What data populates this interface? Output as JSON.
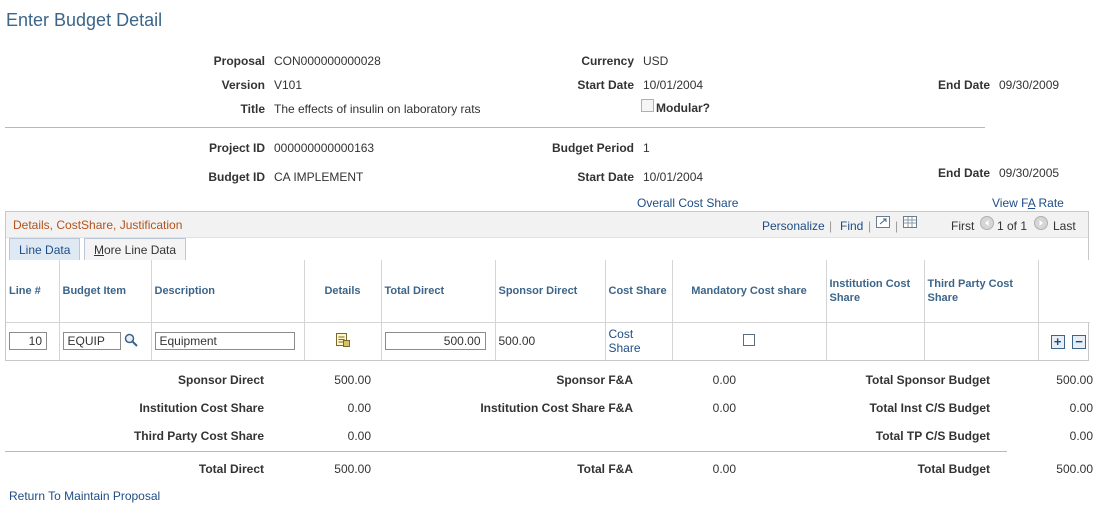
{
  "page": {
    "title": "Enter Budget Detail"
  },
  "header": {
    "proposal_label": "Proposal",
    "proposal": "CON000000000028",
    "currency_label": "Currency",
    "currency": "USD",
    "version_label": "Version",
    "version": "V101",
    "start_date_label": "Start Date",
    "start_date": "10/01/2004",
    "end_date_label": "End Date",
    "end_date": "09/30/2009",
    "title_label": "Title",
    "title": "The effects of insulin on laboratory rats",
    "modular_label": "Modular?",
    "modular_checked": false
  },
  "period": {
    "project_id_label": "Project ID",
    "project_id": "000000000000163",
    "budget_period_label": "Budget Period",
    "budget_period": "1",
    "budget_id_label": "Budget ID",
    "budget_id": "CA IMPLEMENT",
    "start_date_label": "Start Date",
    "start_date": "10/01/2004",
    "end_date_label": "End Date",
    "end_date": "09/30/2005"
  },
  "links": {
    "overall_cost_share": "Overall Cost Share",
    "view_fa_rate": "View FA Rate",
    "return": "Return To Maintain Proposal"
  },
  "grid": {
    "title": "Details, CostShare, Justification",
    "personalize": "Personalize",
    "find": "Find",
    "pager_first": "First",
    "pager_range": "1 of 1",
    "pager_last": "Last",
    "tabs": [
      "Line Data",
      "More Line Data"
    ],
    "columns": {
      "line": "Line #",
      "budget_item": "Budget Item",
      "description": "Description",
      "details": "Details",
      "total_direct": "Total Direct",
      "sponsor_direct": "Sponsor Direct",
      "cost_share": "Cost Share",
      "mandatory_cost_share": "Mandatory Cost share",
      "institution_cost_share": "Institution Cost Share",
      "third_party_cost_share": "Third Party Cost Share"
    },
    "row": {
      "line": "10",
      "budget_item": "EQUIP",
      "description": "Equipment",
      "total_direct": "500.00",
      "sponsor_direct": "500.00",
      "cost_share_link": "Cost Share",
      "mandatory_checked": false
    }
  },
  "totals": {
    "sponsor_direct_label": "Sponsor Direct",
    "sponsor_direct": "500.00",
    "sponsor_fa_label": "Sponsor F&A",
    "sponsor_fa": "0.00",
    "total_sponsor_budget_label": "Total Sponsor Budget",
    "total_sponsor_budget": "500.00",
    "institution_cost_share_label": "Institution Cost Share",
    "institution_cost_share": "0.00",
    "institution_cost_share_fa_label": "Institution Cost Share F&A",
    "institution_cost_share_fa": "0.00",
    "total_inst_cs_budget_label": "Total Inst C/S Budget",
    "total_inst_cs_budget": "0.00",
    "third_party_cost_share_label": "Third Party Cost Share",
    "third_party_cost_share": "0.00",
    "total_tp_cs_budget_label": "Total TP C/S Budget",
    "total_tp_cs_budget": "0.00",
    "total_direct_label": "Total Direct",
    "total_direct": "500.00",
    "total_fa_label": "Total F&A",
    "total_fa": "0.00",
    "total_budget_label": "Total Budget",
    "total_budget": "500.00"
  }
}
